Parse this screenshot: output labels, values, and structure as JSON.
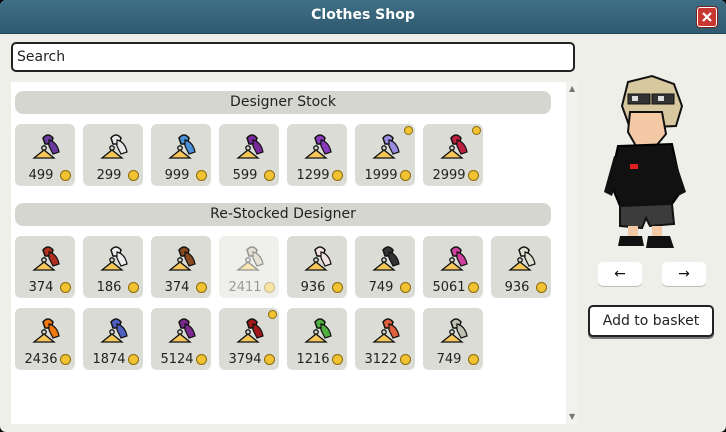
{
  "window": {
    "title": "Clothes Shop"
  },
  "search": {
    "placeholder": "Search"
  },
  "sections": [
    {
      "title": "Designer Stock",
      "items": [
        {
          "price": "499",
          "icon": "purple-hat-icon",
          "color": "#6b3aa0",
          "badge": false,
          "faded": false
        },
        {
          "price": "299",
          "icon": "white-mask-icon",
          "color": "#e8e8e8",
          "badge": false,
          "faded": false
        },
        {
          "price": "999",
          "icon": "blue-accessory-icon",
          "color": "#4a90d9",
          "badge": false,
          "faded": false
        },
        {
          "price": "599",
          "icon": "patterned-shirt-icon",
          "color": "#7a2a9a",
          "badge": false,
          "faded": false
        },
        {
          "price": "1299",
          "icon": "purple-jacket-icon",
          "color": "#8a3ac0",
          "badge": false,
          "faded": false
        },
        {
          "price": "1999",
          "icon": "lavender-outfit-icon",
          "color": "#9a8ae0",
          "badge": true,
          "faded": false
        },
        {
          "price": "2999",
          "icon": "wings-accessory-icon",
          "color": "#c02040",
          "badge": true,
          "faded": false
        }
      ]
    },
    {
      "title": "Re-Stocked Designer",
      "items": [
        {
          "price": "374",
          "icon": "red-headwear-icon",
          "color": "#b03020",
          "badge": false,
          "faded": false
        },
        {
          "price": "186",
          "icon": "white-mask-icon",
          "color": "#eeeeee",
          "badge": false,
          "faded": false
        },
        {
          "price": "374",
          "icon": "brown-hair-icon",
          "color": "#8a4a20",
          "badge": false,
          "faded": false
        },
        {
          "price": "2411",
          "icon": "faded-item-icon",
          "color": "#c8c0a0",
          "badge": false,
          "faded": true
        },
        {
          "price": "936",
          "icon": "white-hat-icon",
          "color": "#f0e0e0",
          "badge": false,
          "faded": false
        },
        {
          "price": "749",
          "icon": "black-hair-icon",
          "color": "#333333",
          "badge": false,
          "faded": false
        },
        {
          "price": "5061",
          "icon": "pink-dress-icon",
          "color": "#d040a0",
          "badge": false,
          "faded": false
        },
        {
          "price": "936",
          "icon": "white-helmet-icon",
          "color": "#e0e0d0",
          "badge": false,
          "faded": false
        },
        {
          "price": "2436",
          "icon": "orange-coat-icon",
          "color": "#f07810",
          "badge": false,
          "faded": false
        },
        {
          "price": "1874",
          "icon": "blue-turban-icon",
          "color": "#5060c0",
          "badge": false,
          "faded": false
        },
        {
          "price": "5124",
          "icon": "purple-robe-icon",
          "color": "#7a2a90",
          "badge": false,
          "faded": false
        },
        {
          "price": "3794",
          "icon": "red-robe-icon",
          "color": "#a01818",
          "badge": true,
          "faded": false
        },
        {
          "price": "1216",
          "icon": "green-hair-icon",
          "color": "#50b040",
          "badge": false,
          "faded": false
        },
        {
          "price": "3122",
          "icon": "colorful-outfit-icon",
          "color": "#e06040",
          "badge": false,
          "faded": false
        },
        {
          "price": "749",
          "icon": "striped-hat-icon",
          "color": "#c0c0b0",
          "badge": false,
          "faded": false
        }
      ]
    }
  ],
  "preview": {
    "prev_label": "←",
    "next_label": "→"
  },
  "basket": {
    "label": "Add to basket"
  },
  "colors": {
    "titlebar": "#3a6a82",
    "coin": "#f1c232",
    "close": "#c8372f"
  }
}
